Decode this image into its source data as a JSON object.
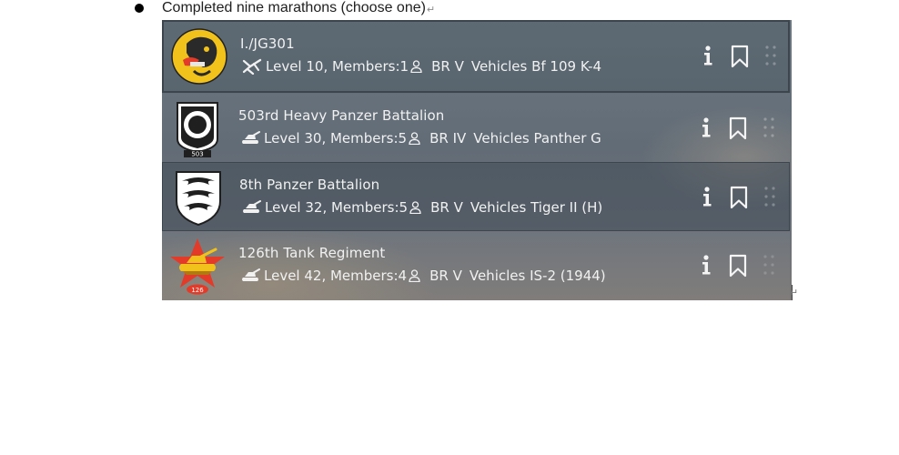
{
  "document": {
    "bullet_text": "Completed nine marathons (choose one)",
    "paragraph_mark": "↵",
    "end_paragraph_mark": "↵"
  },
  "squads": [
    {
      "name": "I./JG301",
      "type_icon": "aircraft-icon",
      "level_text": "Level 10, Members:1",
      "br_text": "BR V",
      "vehicles_text": "Vehicles Bf 109 K-4",
      "emblem": "boar-emblem"
    },
    {
      "name": "503rd Heavy Panzer Battalion",
      "type_icon": "tank-icon",
      "level_text": "Level 30, Members:5",
      "br_text": "BR IV",
      "vehicles_text": "Vehicles Panther G",
      "emblem_label": "503",
      "emblem": "ring-shield-emblem"
    },
    {
      "name": "8th Panzer Battalion",
      "type_icon": "tank-icon",
      "level_text": "Level 32, Members:5",
      "br_text": "BR V",
      "vehicles_text": "Vehicles Tiger II (H)",
      "emblem": "antlers-shield-emblem"
    },
    {
      "name": "126th Tank Regiment",
      "type_icon": "tank-icon",
      "level_text": "Level 42, Members:4",
      "br_text": "BR V",
      "vehicles_text": "Vehicles IS-2 (1944)",
      "emblem_label": "126",
      "emblem": "red-star-tank-emblem"
    }
  ],
  "icons": {
    "info": "info-icon",
    "bookmark": "bookmark-icon",
    "drag": "drag-handle-icon",
    "member": "person-icon"
  },
  "colors": {
    "panel": "#66717b",
    "text": "#f1f1f1",
    "emblem_red": "#e33b2a",
    "emblem_yellow": "#f2c21c"
  }
}
